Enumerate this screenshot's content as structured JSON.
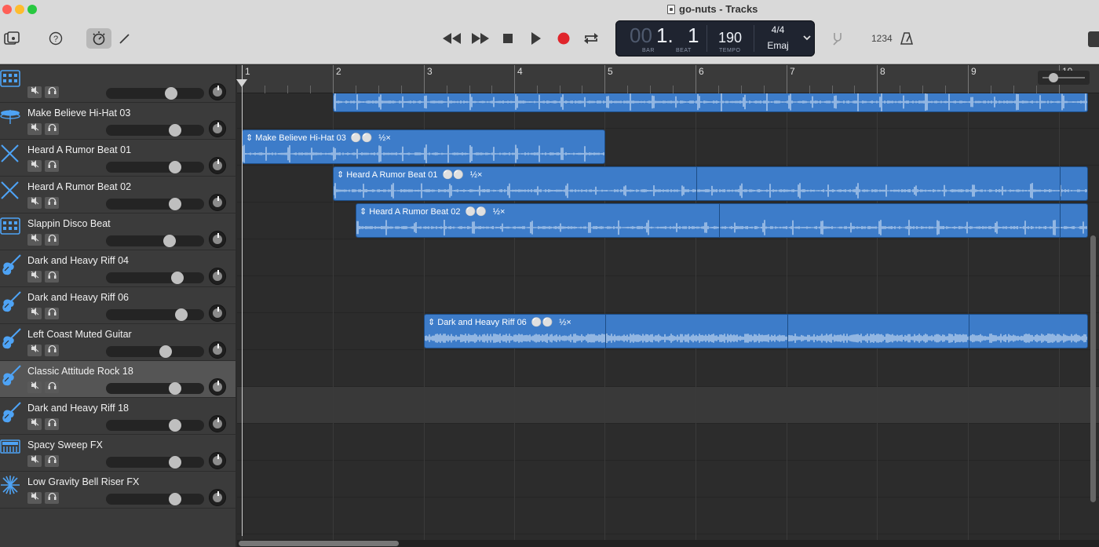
{
  "window": {
    "title": "go-nuts - Tracks"
  },
  "lcd": {
    "bar_prefix": "00",
    "bar_value": "1.",
    "beat_value": "1",
    "bar_label": "BAR",
    "beat_label": "BEAT",
    "tempo_value": "190",
    "tempo_label": "TEMPO",
    "time_signature": "4/4",
    "key": "Emaj"
  },
  "toolbar": {
    "count_in_label": "1234",
    "icons": [
      "library-icon",
      "help-icon",
      "smart-controls-icon",
      "editors-icon",
      "rewind-icon",
      "fast-forward-icon",
      "stop-icon",
      "play-icon",
      "record-icon",
      "cycle-icon",
      "tuner-icon",
      "metronome-icon"
    ],
    "record_color": "#e0252b"
  },
  "ruler": {
    "bars": [
      "1",
      "2",
      "3",
      "4",
      "5",
      "6",
      "7",
      "8",
      "9",
      "10"
    ]
  },
  "tracks": [
    {
      "name": "",
      "icon": "drum-machine-icon"
    },
    {
      "name": "Make Believe Hi-Hat 03",
      "icon": "hihat-icon"
    },
    {
      "name": "Heard A Rumor Beat 01",
      "icon": "drumsticks-icon"
    },
    {
      "name": "Heard A Rumor Beat 02",
      "icon": "drumsticks-icon"
    },
    {
      "name": "Slappin Disco Beat",
      "icon": "drum-machine-icon"
    },
    {
      "name": "Dark and Heavy Riff 04",
      "icon": "guitar-icon"
    },
    {
      "name": "Dark and Heavy Riff 06",
      "icon": "guitar-icon"
    },
    {
      "name": "Left Coast Muted Guitar",
      "icon": "guitar-icon"
    },
    {
      "name": "Classic Attitude Rock 18",
      "icon": "guitar-icon"
    },
    {
      "name": "Dark and Heavy Riff 18",
      "icon": "guitar-icon"
    },
    {
      "name": "Spacy Sweep FX",
      "icon": "synth-icon"
    },
    {
      "name": "Low Gravity Bell Riser FX",
      "icon": "sparkle-icon"
    }
  ],
  "regions": [
    {
      "track": 1,
      "title": "Make Believe Hi-Hat 03",
      "speed": "½×"
    },
    {
      "track": 2,
      "title": "Heard A Rumor Beat 01",
      "speed": "½×"
    },
    {
      "track": 3,
      "title": "Heard A Rumor Beat 02",
      "speed": "½×"
    },
    {
      "track": 6,
      "title": "Dark and Heavy Riff 06",
      "speed": "½×"
    }
  ],
  "colors": {
    "region_blue": "#3d7cc9",
    "accent_blue": "#2f7fd6"
  }
}
